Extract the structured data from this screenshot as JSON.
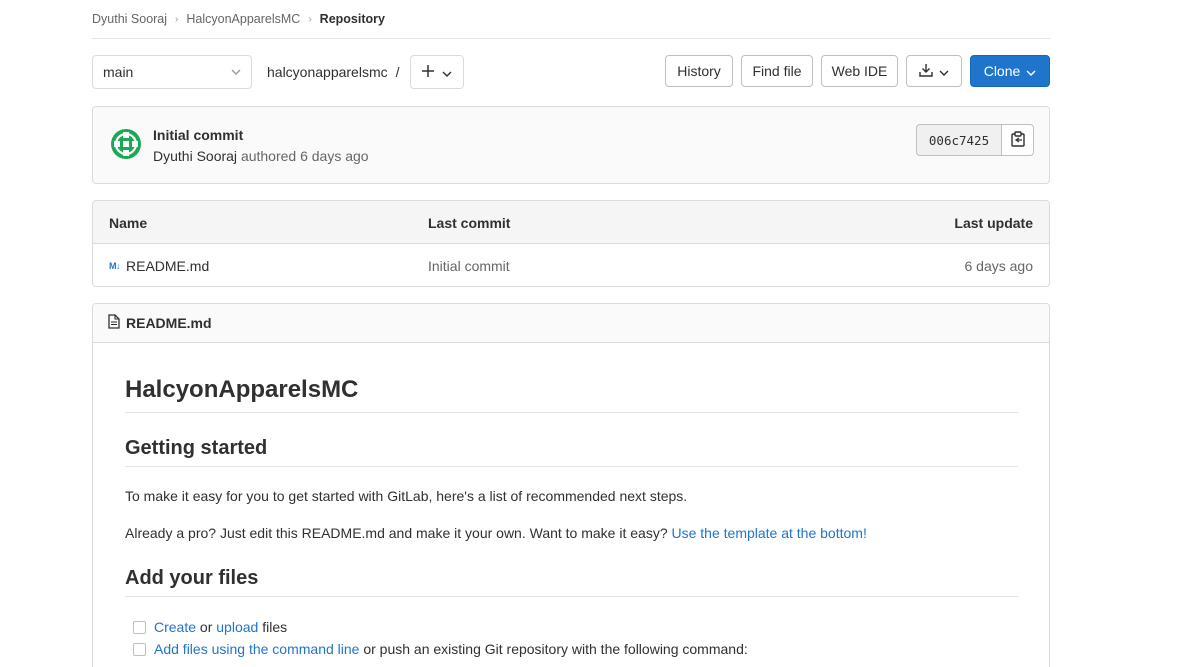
{
  "breadcrumb": {
    "items": [
      "Dyuthi Sooraj",
      "HalcyonApparelsMC",
      "Repository"
    ]
  },
  "toolbar": {
    "branch": "main",
    "path": "halcyonapparelsmc",
    "path_sep": "/",
    "history_label": "History",
    "find_file_label": "Find file",
    "web_ide_label": "Web IDE",
    "clone_label": "Clone"
  },
  "commit": {
    "title": "Initial commit",
    "author": "Dyuthi Sooraj",
    "authored_text": "authored 6 days ago",
    "sha": "006c7425"
  },
  "file_table": {
    "headers": {
      "name": "Name",
      "last_commit": "Last commit",
      "last_update": "Last update"
    },
    "rows": [
      {
        "icon": "M↓",
        "name": "README.md",
        "last_commit": "Initial commit",
        "last_update": "6 days ago"
      }
    ]
  },
  "readme": {
    "filename": "README.md",
    "h1": "HalcyonApparelsMC",
    "h2_getting_started": "Getting started",
    "p1": "To make it easy for you to get started with GitLab, here's a list of recommended next steps.",
    "p2_text": "Already a pro? Just edit this README.md and make it your own. Want to make it easy?",
    "p2_link": "Use the template at the bottom",
    "p2_end": "!",
    "h2_add_files": "Add your files",
    "task1": {
      "link1": "Create",
      "mid": "or",
      "link2": "upload",
      "end": "files"
    },
    "task2": {
      "link": "Add files using the command line",
      "end": "or push an existing Git repository with the following command:"
    }
  },
  "colors": {
    "accent": "#1f75cb",
    "avatar": "#1aaa55"
  }
}
